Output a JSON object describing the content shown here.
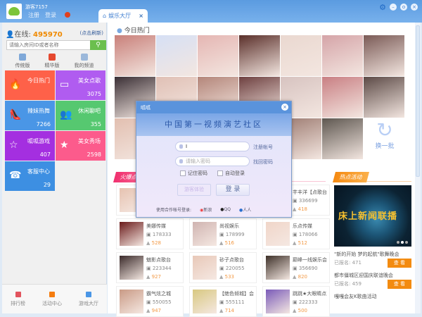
{
  "header": {
    "username": "游客7157",
    "register": "注册",
    "login": "登录",
    "tab_label": "娱乐大厅",
    "tab_close": "×"
  },
  "window": {
    "settings": "⚙",
    "minimize": "–",
    "maximize": "o",
    "close": "×"
  },
  "left": {
    "online_label": "在线:",
    "online_count": "495970",
    "refresh": "(点击刷新)",
    "search_placeholder": "请输入房间ID或者名称",
    "modes": [
      {
        "label": "传统版",
        "color": "#7fa8d8"
      },
      {
        "label": "精华版",
        "color": "#e5482f"
      },
      {
        "label": "我的频道",
        "color": "#9bb8da"
      }
    ],
    "tiles": [
      {
        "label": "今日热门",
        "count": "",
        "icon": "🔥",
        "color": "#fe6149"
      },
      {
        "label": "美女点歌",
        "count": "3075",
        "icon": "▭",
        "color": "#b05cf0"
      },
      {
        "label": "辣妹热舞",
        "count": "7266",
        "icon": "👠",
        "color": "#4a96e6"
      },
      {
        "label": "休闲聊吧",
        "count": "355",
        "icon": "👥",
        "color": "#56c870"
      },
      {
        "label": "呱呱游戏",
        "count": "407",
        "icon": "☆",
        "color": "#a42fe0"
      },
      {
        "label": "美女秀场",
        "count": "2598",
        "icon": "★",
        "color": "#fc5b8c"
      },
      {
        "label": "客服中心",
        "count": "29",
        "icon": "☎",
        "color": "#3d8fe2"
      }
    ],
    "bottom": [
      {
        "label": "排行榜",
        "color": "#e2545e"
      },
      {
        "label": "活动中心",
        "color": "#f57d10"
      },
      {
        "label": "游戏大厅",
        "color": "#4a96e6"
      }
    ]
  },
  "main": {
    "today_hot": "今日热门",
    "refresh_batch": "换一批",
    "hot_section": "火爆点歌",
    "activity_section": "热点活动",
    "cards": [
      {
        "name": "",
        "room": "",
        "count": ""
      },
      {
        "name": "",
        "room": "",
        "count": ""
      },
      {
        "name": "芊丰洋【点歌台",
        "room": "336699",
        "count": "418"
      },
      {
        "name": "美娜传媒",
        "room": "178333",
        "count": "528"
      },
      {
        "name": "尚视娱乐",
        "room": "178999",
        "count": "516"
      },
      {
        "name": "乐点传媒",
        "room": "178066",
        "count": "512"
      },
      {
        "name": "魅影点歌台",
        "room": "223344",
        "count": "927"
      },
      {
        "name": "砂子点歌台",
        "room": "220055",
        "count": "533"
      },
      {
        "name": "巅峰一线娱乐会",
        "room": "356690",
        "count": "820"
      },
      {
        "name": "霸气炫之城",
        "room": "550055",
        "count": "947"
      },
      {
        "name": "【绝色倾城】会",
        "room": "555111",
        "count": "714"
      },
      {
        "name": "跳跳★大眼睛点",
        "room": "222333",
        "count": "500"
      }
    ],
    "banner_title": "床上新闻联播",
    "events": [
      {
        "title": "\"新的开始 梦的起航\"歌舞晚会",
        "signed": "已报名: 471",
        "button": "查 看"
      },
      {
        "title": "都市僵城区迎国庆联谊晚会",
        "signed": "已报名: 459",
        "button": "查 看"
      },
      {
        "title": "嘎嘎会友K歌曲活动",
        "signed": "",
        "button": ""
      }
    ]
  },
  "dialog": {
    "title": "呱呱",
    "banner": "中国第一视频演艺社区",
    "account_value": "I",
    "register_link": "注册帐号",
    "password_placeholder": "请输入密码",
    "recover_link": "找回密码",
    "remember": "记住密码",
    "auto_login": "自动登录",
    "guest": "游客体验",
    "login": "登 录",
    "partner_label": "使用合作帐号登录:",
    "weibo": "新浪",
    "qq": "QQ",
    "renren": "人人"
  }
}
